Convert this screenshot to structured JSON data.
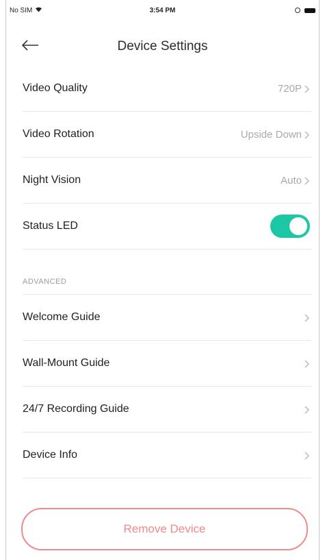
{
  "status_bar": {
    "carrier": "No SIM",
    "time": "3:54 PM"
  },
  "header": {
    "title": "Device Settings"
  },
  "settings": [
    {
      "label": "Video Quality",
      "value": "720P"
    },
    {
      "label": "Video Rotation",
      "value": "Upside Down"
    },
    {
      "label": "Night Vision",
      "value": "Auto"
    }
  ],
  "status_led": {
    "label": "Status LED",
    "enabled": true,
    "color": "#1cc7a6"
  },
  "advanced": {
    "header": "ADVANCED",
    "items": [
      {
        "label": "Welcome Guide"
      },
      {
        "label": "Wall-Mount Guide"
      },
      {
        "label": "24/7 Recording Guide"
      },
      {
        "label": "Device Info"
      }
    ]
  },
  "actions": {
    "remove_label": "Remove Device",
    "remove_color": "#f08a8a"
  }
}
